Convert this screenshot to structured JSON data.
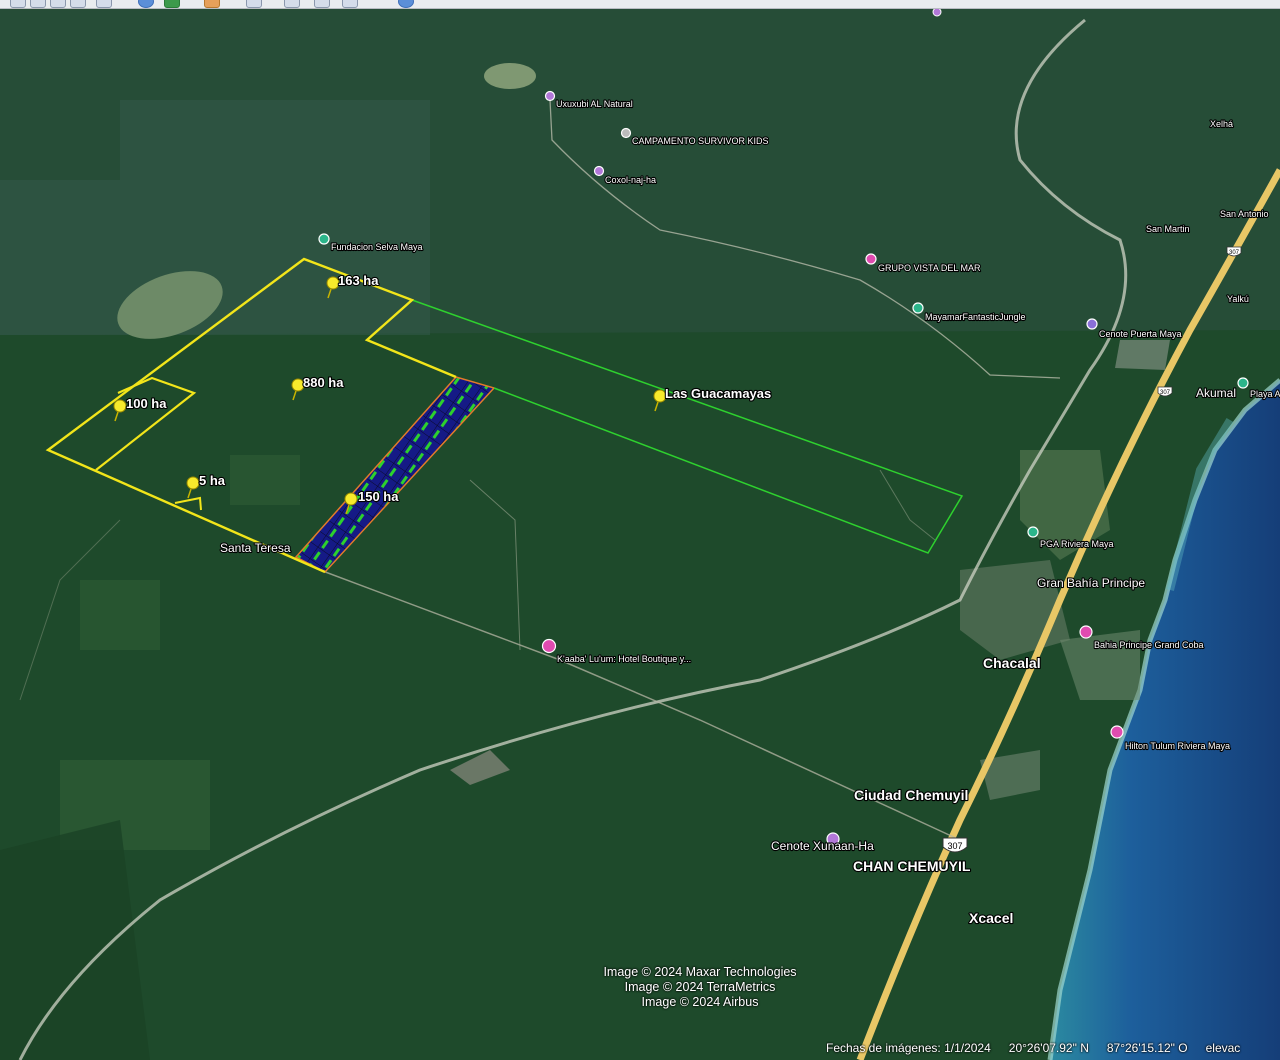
{
  "toolbar": {
    "buttons": [
      "toolbar-btn",
      "toolbar-btn",
      "toolbar-btn",
      "toolbar-btn",
      "toolbar-btn",
      "toolbar-btn",
      "toolbar-btn",
      "toolbar-btn",
      "toolbar-btn",
      "toolbar-btn",
      "toolbar-btn",
      "toolbar-btn",
      "toolbar-btn"
    ]
  },
  "placemarks": {
    "p163": "163 ha",
    "p880": "880 ha",
    "p100": "100 ha",
    "p5": "5 ha",
    "p150": "150 ha",
    "guacamayas": "Las Guacamayas"
  },
  "places": {
    "santa_teresa": "Santa Teresa",
    "xelha": "Xelhá",
    "san_antonio": "San Antonio",
    "san_martin": "San Martin",
    "yalku": "Yalkú",
    "akumal": "Akumal",
    "playa_akumal": "Playa A",
    "gran_bahia": "Gran Bahía Principe",
    "chacalal": "Chacalal",
    "ciudad_chemuyil": "Ciudad Chemuyil",
    "chan_chemuyil": "CHAN CHEMUYIL",
    "xcacel": "Xcacel",
    "route_307": "307"
  },
  "pois": {
    "uxuxubi": "Uxuxubi AL Natural",
    "survivor": "CAMPAMENTO SURVIVOR KIDS",
    "coxol": "Coxol-naj-ha",
    "selva_maya": "Fundacion Selva Maya",
    "vista_mar": "GRUPO VISTA DEL MAR",
    "mayamar": "MayamarFantasticJungle",
    "cenote_puerta": "Cenote Puerta Maya",
    "pga": "PGA Riviera Maya",
    "bahia_grand_coba": "Bahia Principe Grand Coba",
    "kaaba": "K'aaba' Lu'um: Hotel Boutique y...",
    "hilton": "Hilton Tulum Riviera Maya",
    "cenote_xunaan": "Cenote Xunaan-Ha"
  },
  "credits": [
    "Image © 2024 Maxar Technologies",
    "Image © 2024 TerraMetrics",
    "Image © 2024 Airbus"
  ],
  "status": {
    "imagery_date": "Fechas de imágenes: 1/1/2024",
    "lat": "20°26'07.92\" N",
    "lon": "87°26'15.12\" O",
    "elevation": "elevac"
  },
  "colors": {
    "property_outline": "#f2e51a",
    "guacamayas_outline": "#2ed12e",
    "development_grid": "#1a1f8f",
    "ocean": "#1d6aa8",
    "highway": "#e8c766"
  }
}
